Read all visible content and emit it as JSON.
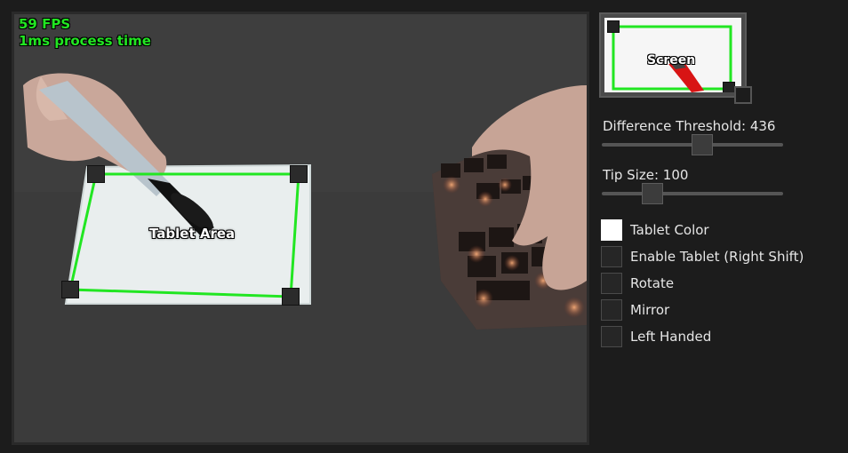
{
  "camera": {
    "fps_text": "59 FPS",
    "process_text": "1ms process time",
    "area_label": "Tablet Area",
    "outline_color": "#22e622"
  },
  "preview": {
    "label": "Screen"
  },
  "controls": {
    "difference_threshold": {
      "label": "Difference Threshold: 436",
      "value": 436,
      "position_fraction": 0.56
    },
    "tip_size": {
      "label": "Tip Size: 100",
      "value": 100,
      "position_fraction": 0.25
    },
    "checkboxes": [
      {
        "label": "Tablet Color",
        "checked": true
      },
      {
        "label": "Enable Tablet (Right Shift)",
        "checked": false
      },
      {
        "label": "Rotate",
        "checked": false
      },
      {
        "label": "Mirror",
        "checked": false
      },
      {
        "label": "Left Handed",
        "checked": false
      }
    ]
  }
}
